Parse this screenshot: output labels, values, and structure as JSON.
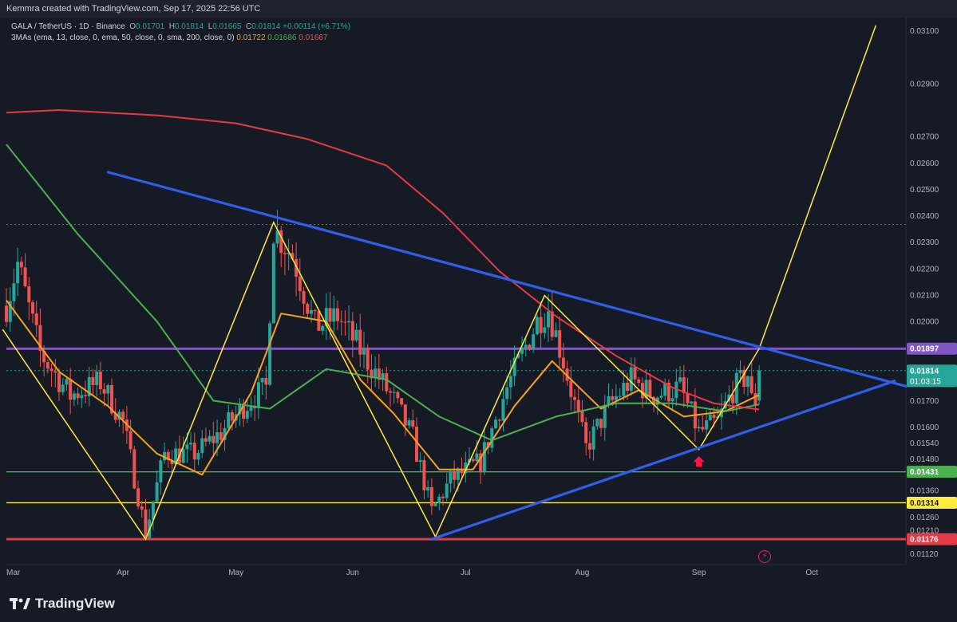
{
  "header": {
    "text": "Kemmra created with TradingView.com, Sep 17, 2025 22:56 UTC"
  },
  "legend": {
    "symbol": "GALA / TetherUS · 1D · Binance",
    "open_label": "O",
    "open": "0.01701",
    "high_label": "H",
    "high": "0.01814",
    "low_label": "L",
    "low": "0.01665",
    "close_label": "C",
    "close": "0.01814",
    "change": "+0.00114 (+6.71%)",
    "ma_label": "3MAs (ema, 13, close, 0, ema, 50, close, 0, sma, 200, close, 0)",
    "ma1": "0.01722",
    "ma2": "0.01686",
    "ma3": "0.01667"
  },
  "brand": {
    "name": "TradingView"
  },
  "icons": {
    "logo": "tradingview-logo-icon",
    "flash": "lightning-icon"
  },
  "colors": {
    "bg": "#161a25",
    "up": "#26a69a",
    "down": "#ef5350",
    "ema13": "#f7a21b",
    "ema50": "#4caf50",
    "sma200": "#e53946",
    "trend": "#2f5fe8",
    "zigzag": "#ffeb3b",
    "resistance": "#7e57c2"
  },
  "chart_data": {
    "type": "candlestick",
    "ylim": [
      0.0108,
      0.0315
    ],
    "y_ticks": [
      "0.03100",
      "0.02900",
      "0.02700",
      "0.02600",
      "0.02500",
      "0.02400",
      "0.02300",
      "0.02200",
      "0.02100",
      "0.02000",
      "0.01700",
      "0.01600",
      "0.01540",
      "0.01480",
      "0.01360",
      "0.01260",
      "0.01210",
      "0.01120"
    ],
    "x_ticks": [
      {
        "label": "Mar",
        "date": "2025-03-01"
      },
      {
        "label": "Apr",
        "date": "2025-04-01"
      },
      {
        "label": "May",
        "date": "2025-05-01"
      },
      {
        "label": "Jun",
        "date": "2025-06-01"
      },
      {
        "label": "Jul",
        "date": "2025-07-01"
      },
      {
        "label": "Aug",
        "date": "2025-08-01"
      },
      {
        "label": "Sep",
        "date": "2025-09-01"
      },
      {
        "label": "Oct",
        "date": "2025-10-01"
      }
    ],
    "x_range": [
      "2025-03-01",
      "2025-10-26"
    ],
    "last_date": "2025-09-17",
    "price_labels": [
      {
        "value": 0.01897,
        "text": "0.01897",
        "color": "#7e57c2"
      },
      {
        "value": 0.01814,
        "text": "0.01814",
        "sub": "01:03:15",
        "color": "#26a69a"
      },
      {
        "value": 0.01431,
        "text": "0.01431",
        "color": "#4caf50"
      },
      {
        "value": 0.01314,
        "text": "0.01314",
        "color": "#ffeb3b"
      },
      {
        "value": 0.01176,
        "text": "0.01176",
        "color": "#e53946"
      }
    ],
    "horizontal_lines": [
      {
        "value": 0.01897,
        "color": "#7e57c2",
        "width": 3
      },
      {
        "value": 0.01431,
        "color": "#4caf50",
        "width": 1.3
      },
      {
        "value": 0.01314,
        "color": "#ffeb3b",
        "width": 1.3
      },
      {
        "value": 0.01176,
        "color": "#e53946",
        "width": 3
      },
      {
        "value": 0.02367,
        "color": "#6b6f7a",
        "width": 1,
        "dash": true
      },
      {
        "value": 0.01814,
        "color": "#26a69a",
        "width": 1,
        "dash": true
      }
    ],
    "trendlines": [
      {
        "name": "descending",
        "color": "#2f5fe8",
        "points": [
          [
            "2025-03-28",
            0.02565
          ],
          [
            "2025-10-26",
            0.01755
          ]
        ]
      },
      {
        "name": "ascending",
        "color": "#2f5fe8",
        "points": [
          [
            "2025-06-22",
            0.01176
          ],
          [
            "2025-10-23",
            0.01775
          ]
        ]
      }
    ],
    "zigzag": {
      "color": "#ffeb3b",
      "points": [
        [
          "2025-02-28",
          0.0197
        ],
        [
          "2025-04-07",
          0.01176
        ],
        [
          "2025-05-11",
          0.02375
        ],
        [
          "2025-06-23",
          0.01185
        ],
        [
          "2025-07-22",
          0.02098
        ],
        [
          "2025-09-01",
          0.01515
        ],
        [
          "2025-09-17",
          0.01897
        ],
        [
          "2025-10-18",
          0.0312
        ]
      ]
    },
    "marker": {
      "date": "2025-09-01",
      "value": 0.0149,
      "shape": "up-arrow",
      "color": "#ff1744"
    },
    "moving_averages": [
      {
        "label": "ema13",
        "color": "#f7a21b",
        "points": [
          [
            "2025-03-01",
            0.0208
          ],
          [
            "2025-03-15",
            0.0181
          ],
          [
            "2025-03-28",
            0.0168
          ],
          [
            "2025-04-10",
            0.015
          ],
          [
            "2025-04-22",
            0.0142
          ],
          [
            "2025-05-05",
            0.0173
          ],
          [
            "2025-05-13",
            0.0203
          ],
          [
            "2025-05-25",
            0.02
          ],
          [
            "2025-06-03",
            0.0178
          ],
          [
            "2025-06-12",
            0.0165
          ],
          [
            "2025-06-24",
            0.0144
          ],
          [
            "2025-07-03",
            0.0144
          ],
          [
            "2025-07-14",
            0.0168
          ],
          [
            "2025-07-24",
            0.0185
          ],
          [
            "2025-08-06",
            0.0167
          ],
          [
            "2025-08-16",
            0.0174
          ],
          [
            "2025-08-28",
            0.0164
          ],
          [
            "2025-09-08",
            0.0166
          ],
          [
            "2025-09-17",
            0.01722
          ]
        ]
      },
      {
        "label": "ema50",
        "color": "#4caf50",
        "points": [
          [
            "2025-03-01",
            0.0267
          ],
          [
            "2025-03-20",
            0.0233
          ],
          [
            "2025-04-10",
            0.02
          ],
          [
            "2025-04-25",
            0.017
          ],
          [
            "2025-05-10",
            0.0167
          ],
          [
            "2025-05-25",
            0.0182
          ],
          [
            "2025-06-10",
            0.0178
          ],
          [
            "2025-06-24",
            0.0164
          ],
          [
            "2025-07-08",
            0.0155
          ],
          [
            "2025-07-25",
            0.0164
          ],
          [
            "2025-08-10",
            0.0169
          ],
          [
            "2025-08-25",
            0.0169
          ],
          [
            "2025-09-08",
            0.0166
          ],
          [
            "2025-09-17",
            0.01686
          ]
        ]
      },
      {
        "label": "sma200",
        "color": "#e53946",
        "points": [
          [
            "2025-03-01",
            0.0279
          ],
          [
            "2025-03-15",
            0.028
          ],
          [
            "2025-04-10",
            0.0278
          ],
          [
            "2025-05-01",
            0.0275
          ],
          [
            "2025-05-20",
            0.0269
          ],
          [
            "2025-06-10",
            0.0259
          ],
          [
            "2025-06-25",
            0.0241
          ],
          [
            "2025-07-10",
            0.0219
          ],
          [
            "2025-07-25",
            0.0202
          ],
          [
            "2025-08-10",
            0.0187
          ],
          [
            "2025-08-25",
            0.0175
          ],
          [
            "2025-09-05",
            0.0169
          ],
          [
            "2025-09-17",
            0.01667
          ]
        ]
      }
    ],
    "price_anchors": [
      [
        "2025-03-01",
        0.0206
      ],
      [
        "2025-03-04",
        0.0222
      ],
      [
        "2025-03-10",
        0.0188
      ],
      [
        "2025-03-18",
        0.0172
      ],
      [
        "2025-03-26",
        0.0177
      ],
      [
        "2025-04-01",
        0.0162
      ],
      [
        "2025-04-07",
        0.012
      ],
      [
        "2025-04-12",
        0.015
      ],
      [
        "2025-04-20",
        0.015
      ],
      [
        "2025-04-27",
        0.0158
      ],
      [
        "2025-05-03",
        0.0168
      ],
      [
        "2025-05-09",
        0.0175
      ],
      [
        "2025-05-11",
        0.0235
      ],
      [
        "2025-05-16",
        0.0225
      ],
      [
        "2025-05-22",
        0.0198
      ],
      [
        "2025-05-28",
        0.0202
      ],
      [
        "2025-06-05",
        0.0185
      ],
      [
        "2025-06-12",
        0.017
      ],
      [
        "2025-06-17",
        0.0156
      ],
      [
        "2025-06-22",
        0.0128
      ],
      [
        "2025-06-27",
        0.014
      ],
      [
        "2025-07-05",
        0.0147
      ],
      [
        "2025-07-12",
        0.0175
      ],
      [
        "2025-07-20",
        0.02
      ],
      [
        "2025-07-23",
        0.0205
      ],
      [
        "2025-07-27",
        0.0185
      ],
      [
        "2025-08-02",
        0.0152
      ],
      [
        "2025-08-08",
        0.0168
      ],
      [
        "2025-08-14",
        0.0178
      ],
      [
        "2025-08-20",
        0.0172
      ],
      [
        "2025-08-27",
        0.0175
      ],
      [
        "2025-09-01",
        0.0158
      ],
      [
        "2025-09-06",
        0.0162
      ],
      [
        "2025-09-10",
        0.0174
      ],
      [
        "2025-09-14",
        0.018
      ],
      [
        "2025-09-15",
        0.017
      ],
      [
        "2025-09-16",
        0.01701
      ],
      [
        "2025-09-17",
        0.01814
      ]
    ]
  }
}
